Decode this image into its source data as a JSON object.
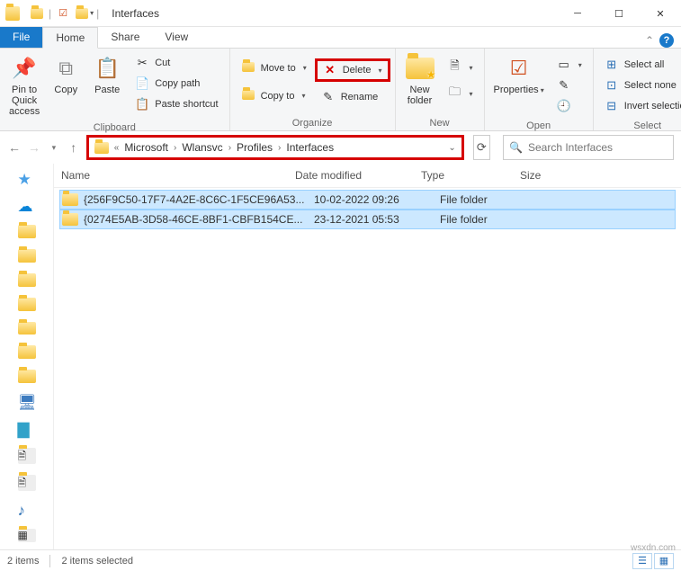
{
  "titlebar": {
    "title": "Interfaces"
  },
  "tabs": {
    "file": "File",
    "home": "Home",
    "share": "Share",
    "view": "View"
  },
  "ribbon": {
    "clipboard": {
      "label": "Clipboard",
      "pin": "Pin to Quick access",
      "copy": "Copy",
      "paste": "Paste",
      "cut": "Cut",
      "copy_path": "Copy path",
      "paste_shortcut": "Paste shortcut"
    },
    "organize": {
      "label": "Organize",
      "move_to": "Move to",
      "copy_to": "Copy to",
      "delete": "Delete",
      "rename": "Rename"
    },
    "new": {
      "label": "New",
      "new_folder": "New folder"
    },
    "open": {
      "label": "Open",
      "properties": "Properties"
    },
    "select": {
      "label": "Select",
      "all": "Select all",
      "none": "Select none",
      "invert": "Invert selection"
    }
  },
  "breadcrumbs": [
    "Microsoft",
    "Wlansvc",
    "Profiles",
    "Interfaces"
  ],
  "search": {
    "placeholder": "Search Interfaces"
  },
  "columns": {
    "name": "Name",
    "date": "Date modified",
    "type": "Type",
    "size": "Size"
  },
  "rows": [
    {
      "name": "{256F9C50-17F7-4A2E-8C6C-1F5CE96A53...",
      "date": "10-02-2022 09:26",
      "type": "File folder"
    },
    {
      "name": "{0274E5AB-3D58-46CE-8BF1-CBFB154CE...",
      "date": "23-12-2021 05:53",
      "type": "File folder"
    }
  ],
  "status": {
    "items": "2 items",
    "selected": "2 items selected"
  },
  "watermark": "wsxdn.com"
}
